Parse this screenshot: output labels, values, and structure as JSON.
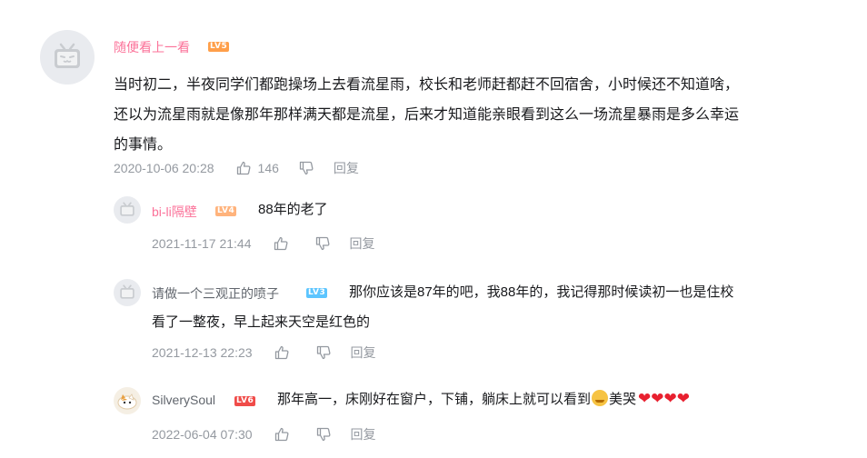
{
  "comment": {
    "username": "随便看上一看",
    "level": "LV5",
    "lines": [
      "当时初二，半夜同学们都跑操场上去看流星雨，校长和老师赶都赶不回宿舍，小时候还不知道啥，",
      "还以为流星雨就是像那年那样满天都是流星，后来才知道能亲眼看到这么一场流星暴雨是多么幸运",
      "的事情。"
    ],
    "time": "2020-10-06 20:28",
    "likes": "146",
    "reply_label": "回复"
  },
  "replies": [
    {
      "username": "bi-li隔壁",
      "level": "LV4",
      "text": "88年的老了",
      "time": "2021-11-17 21:44",
      "reply_label": "回复"
    },
    {
      "username": "请做一个三观正的喷子",
      "level": "LV3",
      "text_line1": "那你应该是87年的吧，我88年的，我记得那时候读初一也是住校",
      "text_line2": "看了一整夜，早上起来天空是红色的",
      "time": "2021-12-13 22:23",
      "reply_label": "回复"
    },
    {
      "username": "SilverySoul",
      "level": "LV6",
      "text": "那年高一，床刚好在窗户，下铺，躺床上就可以看到",
      "text_after_emoji": "美哭",
      "hearts": "❤❤❤❤",
      "time": "2022-06-04 07:30",
      "reply_label": "回复"
    }
  ],
  "colors": {
    "username_pink": "#fb7299",
    "lv5": "#ff9f4a",
    "lv4": "#ffb37c",
    "lv3": "#5cc5ff",
    "lv6": "#f04c49",
    "meta_gray": "#9499a0"
  },
  "icons": [
    "tv-avatar-icon",
    "thumb-up-icon",
    "thumb-down-icon",
    "crying-emoji-icon",
    "heart-icon"
  ]
}
